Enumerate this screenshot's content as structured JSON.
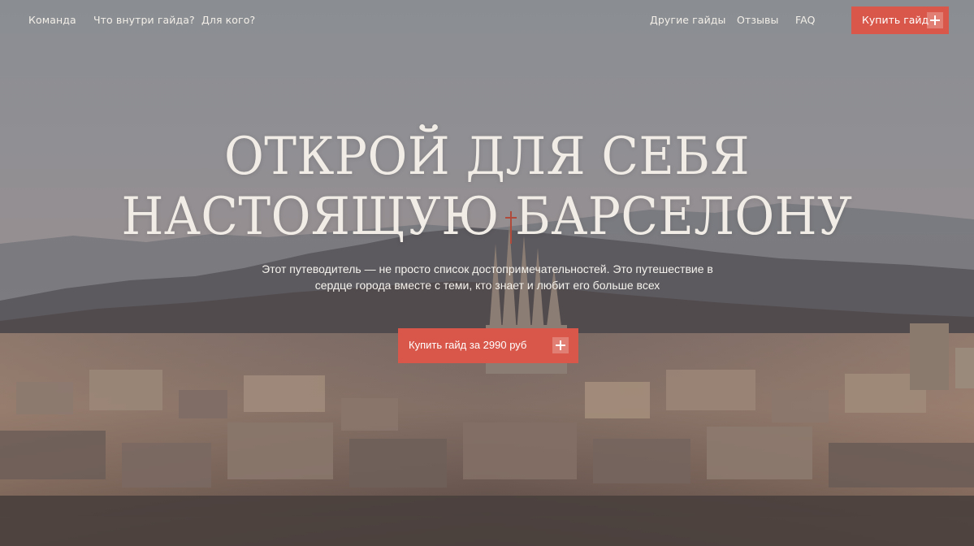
{
  "nav": {
    "left_links": [
      "Команда",
      "Что внутри гайда?",
      "Для кого?"
    ],
    "right_links": [
      "Другие гайды",
      "Отзывы",
      "FAQ"
    ],
    "buy_label": "Купить гайд"
  },
  "hero": {
    "title_line1": "ОТКРОЙ ДЛЯ СЕБЯ",
    "title_line2": "НАСТОЯЩУЮ БАРСЕЛОНУ",
    "subtitle_line1": "Этот путеводитель — не просто список достопримечательностей. Это путешествие в",
    "subtitle_line2": "сердце города вместе с теми, кто знает и любит его больше всех",
    "cta_label": "Купить гайд за 2990 руб"
  },
  "icons": {
    "nav_buy": "plus-icon",
    "cta": "plus-icon"
  },
  "colors": {
    "accent": "#d8574a",
    "text_light": "#f1ede6",
    "sky": "#8a8e93"
  }
}
